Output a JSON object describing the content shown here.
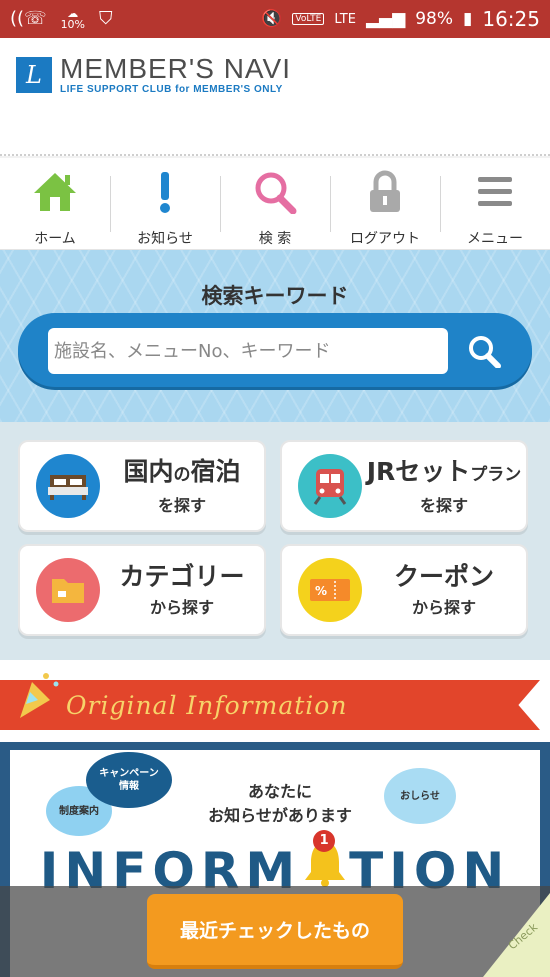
{
  "status_bar": {
    "battery": "98%",
    "time": "16:25",
    "network": "LTE",
    "volte": "VoLTE",
    "weather_temp": "10%"
  },
  "header": {
    "brand": "MEMBER'S NAVI",
    "tagline": "LIFE SUPPORT CLUB for MEMBER'S ONLY"
  },
  "nav": {
    "home": "ホーム",
    "notice": "お知らせ",
    "search": "検 索",
    "logout": "ログアウト",
    "menu": "メニュー"
  },
  "search": {
    "title": "検索キーワード",
    "placeholder": "施設名、メニューNo、キーワード"
  },
  "cards": {
    "domestic": {
      "main_a": "国内",
      "main_no": "の",
      "main_b": "宿泊",
      "sub": "を探す"
    },
    "jr": {
      "main": "JRセット",
      "small": "プラン",
      "sub": "を探す"
    },
    "category": {
      "main": "カテゴリー",
      "sub": "から探す"
    },
    "coupon": {
      "main": "クーポン",
      "sub": "から探す"
    }
  },
  "original_info": {
    "title": "Original Information"
  },
  "information": {
    "bubble_system": "制度案内",
    "bubble_campaign_l1": "キャンペーン",
    "bubble_campaign_l2": "情報",
    "bubble_notice": "おしらせ",
    "message_l1": "あなたに",
    "message_l2": "お知らせがあります",
    "big_a": "INFORM",
    "big_b": "TION",
    "badge": "1"
  },
  "bottom": {
    "recent_label": "最近チェックしたもの",
    "check_label": "Check"
  },
  "colors": {
    "status_bar": "#b5362f",
    "accent_blue": "#1f83c8",
    "ribbon_red": "#e2452b",
    "orange": "#f39a1f"
  }
}
